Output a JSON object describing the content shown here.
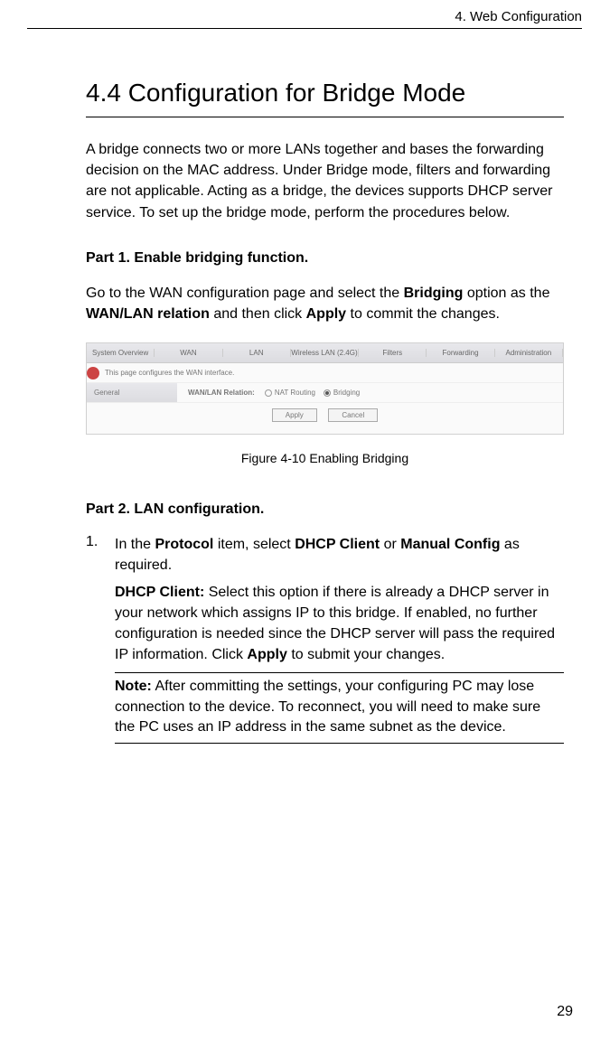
{
  "header": {
    "chapter_label": "4. Web Configuration"
  },
  "section": {
    "title": "4.4 Configuration for Bridge Mode",
    "intro": "A bridge connects two or more LANs together and bases the forwarding decision on the MAC address. Under Bridge mode, filters and forwarding are not applicable. Acting as a bridge, the devices supports DHCP server service. To set up the bridge mode, perform the procedures below."
  },
  "part1": {
    "heading": "Part 1. Enable bridging function.",
    "body_pre": "Go to the WAN configuration page and select the ",
    "bold1": "Bridging",
    "body_mid1": " option as the ",
    "bold2": "WAN/LAN relation",
    "body_mid2": " and then click ",
    "bold3": "Apply",
    "body_post": " to commit the changes."
  },
  "screenshot": {
    "tabs": [
      "System Overview",
      "WAN",
      "LAN",
      "Wireless LAN (2.4G)",
      "Filters",
      "Forwarding",
      "Administration"
    ],
    "desc_text": "This page configures the WAN interface.",
    "row_label": "General",
    "field_label": "WAN/LAN Relation:",
    "radio1": "NAT Routing",
    "radio2": "Bridging",
    "btn_apply": "Apply",
    "btn_cancel": "Cancel"
  },
  "figure_caption": "Figure 4-10    Enabling Bridging",
  "part2": {
    "heading": "Part 2. LAN configuration.",
    "item1": {
      "number": "1.",
      "line1_pre": "In the ",
      "line1_b1": "Protocol",
      "line1_mid1": " item, select ",
      "line1_b2": "DHCP Client",
      "line1_mid2": " or ",
      "line1_b3": "Manual Config",
      "line1_post": " as required.",
      "para2_b": "DHCP Client:",
      "para2_text1": " Select this option if there is already a DHCP server in your network which assigns IP to this bridge. If enabled, no further configuration is needed since the DHCP server will pass the required IP information. Click ",
      "para2_b2": "Apply",
      "para2_text2": " to submit your changes.",
      "note_b": "Note:",
      "note_text": " After committing the settings, your configuring PC may lose connection to the device. To reconnect, you will need to make sure the PC uses an IP address in the same subnet as the device."
    }
  },
  "page_number": "29"
}
